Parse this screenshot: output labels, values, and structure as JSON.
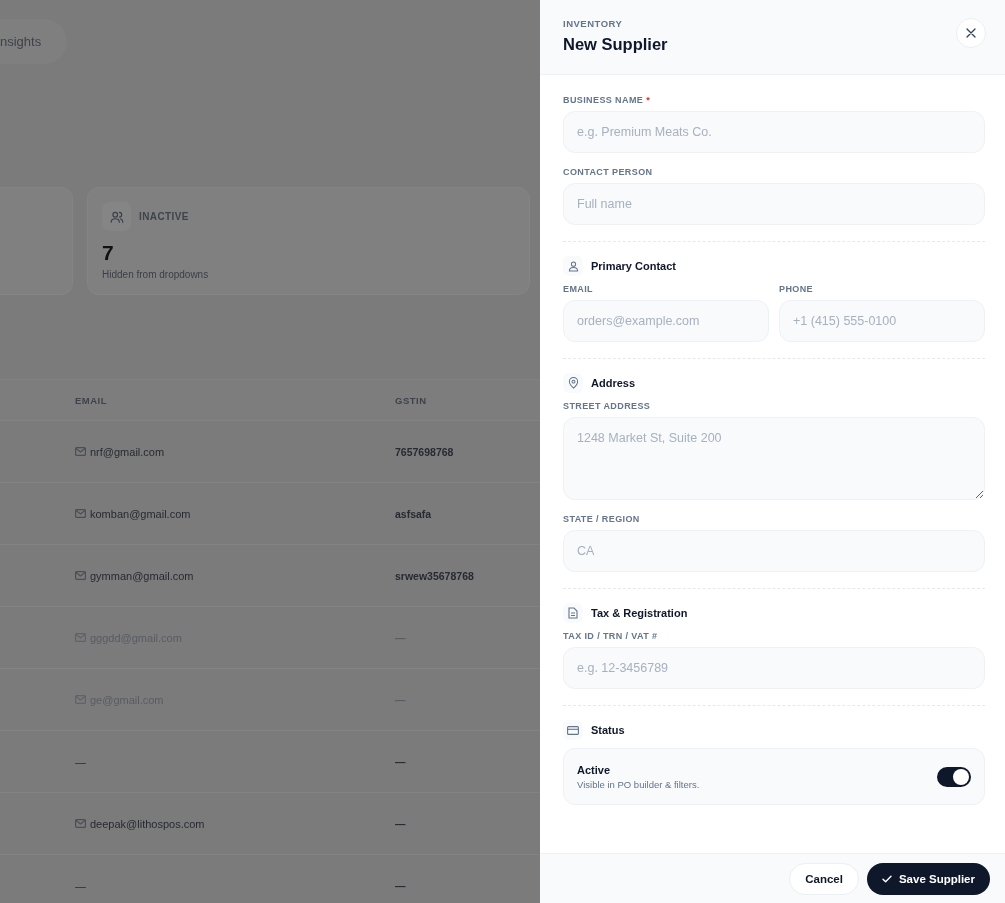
{
  "background": {
    "tab": {
      "label": "nsights"
    },
    "stats": [
      {
        "label": "INACTIVE",
        "value": "7",
        "note": "Hidden from dropdowns"
      }
    ],
    "table": {
      "columns": [
        "EMAIL",
        "GSTIN"
      ],
      "rows": [
        {
          "email": "nrf@gmail.com",
          "mail_icon": true,
          "gstin": "7657698768",
          "muted": false
        },
        {
          "email": "komban@gmail.com",
          "mail_icon": true,
          "gstin": "asfsafa",
          "muted": false
        },
        {
          "email": "gymman@gmail.com",
          "mail_icon": true,
          "gstin": "srwew35678768",
          "muted": false
        },
        {
          "email": "gggdd@gmail.com",
          "mail_icon": true,
          "gstin": "—",
          "muted": true
        },
        {
          "email": "ge@gmail.com",
          "mail_icon": true,
          "gstin": "—",
          "muted": true
        },
        {
          "email": "—",
          "mail_icon": false,
          "gstin": "—",
          "muted": false
        },
        {
          "email": "deepak@lithospos.com",
          "mail_icon": true,
          "gstin": "—",
          "muted": false
        },
        {
          "email": "—",
          "mail_icon": false,
          "gstin": "—",
          "muted": false
        }
      ]
    }
  },
  "panel": {
    "eyebrow": "INVENTORY",
    "title": "New Supplier",
    "sections": [
      {
        "rows": [
          [
            {
              "kind": "input",
              "label": "BUSINESS NAME",
              "required_mark": "*",
              "placeholder": "e.g. Premium Meats Co."
            }
          ],
          [
            {
              "kind": "input",
              "label": "CONTACT PERSON",
              "placeholder": "Full name"
            }
          ]
        ]
      },
      {
        "kind": "person",
        "heading": "Primary Contact",
        "rows": [
          [
            {
              "kind": "input",
              "label": "EMAIL",
              "placeholder": "orders@example.com"
            },
            {
              "kind": "input",
              "label": "PHONE",
              "placeholder": "+1 (415) 555-0100"
            }
          ]
        ]
      },
      {
        "kind": "location",
        "heading": "Address",
        "rows": [
          [
            {
              "kind": "textarea",
              "label": "STREET ADDRESS",
              "placeholder": "1248 Market St, Suite 200"
            }
          ],
          [
            {
              "kind": "input",
              "label": "STATE / REGION",
              "placeholder": "CA"
            }
          ]
        ]
      },
      {
        "kind": "document",
        "heading": "Tax & Registration",
        "rows": [
          [
            {
              "kind": "input",
              "label": "TAX ID / TRN / VAT #",
              "placeholder": "e.g. 12-3456789"
            }
          ]
        ]
      },
      {
        "kind": "card",
        "heading": "Status",
        "toggle": {
          "label": "Active",
          "description": "Visible in PO builder & filters.",
          "on": true
        }
      }
    ],
    "buttons": [
      {
        "kind": "secondary",
        "label": "Cancel"
      },
      {
        "kind": "primary",
        "label": "Save Supplier"
      }
    ]
  }
}
